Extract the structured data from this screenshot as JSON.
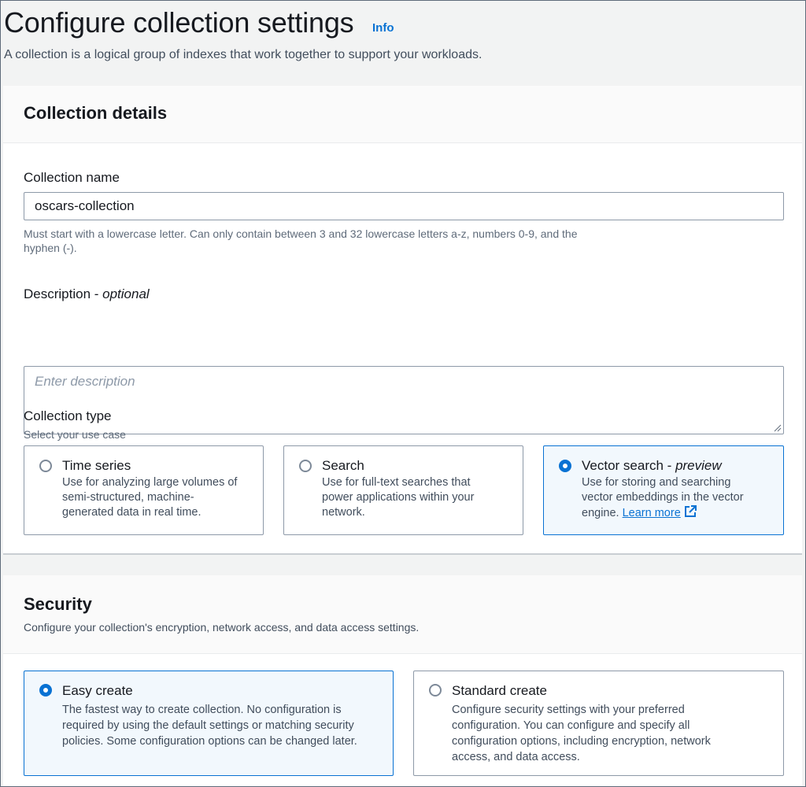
{
  "header": {
    "title": "Configure collection settings",
    "info_link": "Info",
    "description": "A collection is a logical group of indexes that work together to support your workloads."
  },
  "collection_details": {
    "title": "Collection details",
    "name_label": "Collection name",
    "name_value": "oscars-collection",
    "name_hint_line1": "Must start with a lowercase letter. Can only contain between 3 and 32 lowercase letters a-z, numbers 0-9, and the",
    "name_hint_line2": "hyphen (-).",
    "description_label": "Description - ",
    "description_optional": "optional",
    "description_placeholder": "Enter description",
    "type_label": "Collection type",
    "type_hint": "Select your use case",
    "types": [
      {
        "title": "Time series",
        "desc": [
          "Use for analyzing large volumes of",
          "semi-structured, machine-",
          "generated data in real time."
        ],
        "selected": false
      },
      {
        "title": "Search",
        "desc": [
          "Use for full-text searches that",
          "power applications within your",
          "network."
        ],
        "selected": false
      },
      {
        "title": "Vector search - ",
        "title_italic": "preview",
        "desc": [
          "Use for storing and searching",
          "vector embeddings in the vector",
          "engine. "
        ],
        "link": "Learn more",
        "selected": true
      }
    ]
  },
  "security": {
    "title": "Security",
    "description": "Configure your collection's encryption, network access, and data access settings.",
    "options": [
      {
        "title": "Easy create",
        "desc": [
          "The fastest way to create collection. No configuration is",
          "required by using the default settings or matching security",
          "policies. Some configuration options can be changed later."
        ],
        "selected": true
      },
      {
        "title": "Standard create",
        "desc": [
          "Configure security settings with your preferred",
          "configuration. You can configure and specify all",
          "configuration options, including encryption, network",
          "access, and data access."
        ],
        "selected": false
      }
    ]
  },
  "colors": {
    "accent": "#0972d3",
    "selected_bg": "#f2f8fd",
    "border": "#8d99a8"
  }
}
